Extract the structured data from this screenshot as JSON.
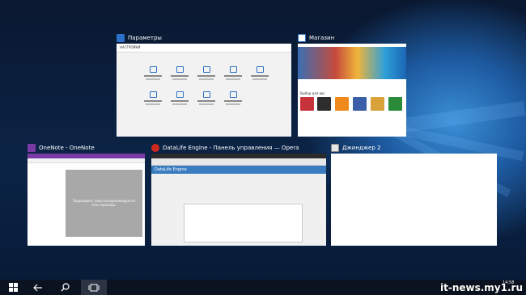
{
  "windows": {
    "settings": {
      "title": "Параметры",
      "header": "НАСТРОЙКИ"
    },
    "store": {
      "title": "Магазин",
      "section": "Выбор для вас"
    },
    "onenote": {
      "title": "OneNote - OneNote",
      "page_text_1": "Подождите, пока синхронизируется",
      "page_text_2": "эта страница."
    },
    "opera": {
      "title": "DataLife Engine - Панель управления — Opera",
      "app_header": "DataLife Engine"
    },
    "notepad": {
      "title": "Джинджер 2"
    }
  },
  "taskbar": {
    "clock": "14:58"
  },
  "watermark": "it-news.my1.ru",
  "colors": {
    "settings_icon": "#2b70c9",
    "store_icon": "#2b70c9",
    "onenote_icon": "#7a3aa5",
    "opera_icon": "#d0281e"
  }
}
